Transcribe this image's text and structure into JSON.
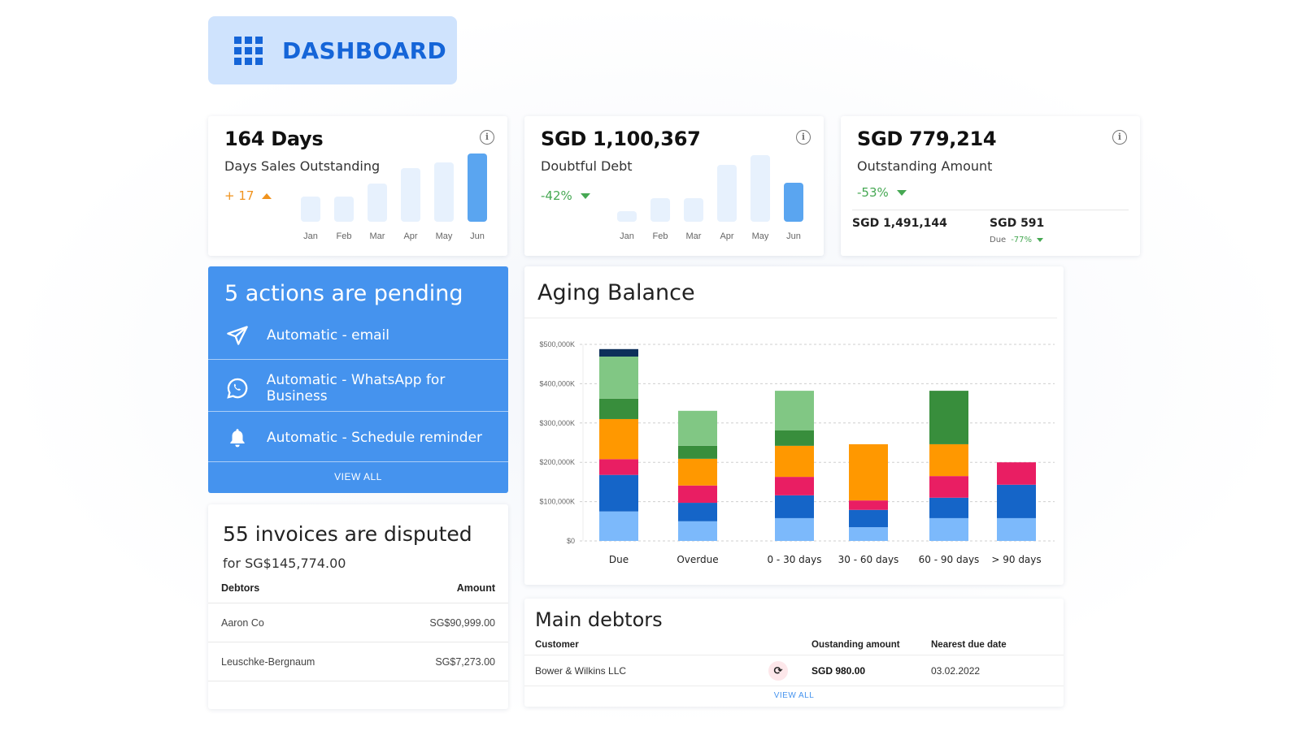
{
  "header": {
    "title": "DASHBOARD",
    "icon": "grid-icon",
    "bg_color": "#cfe3fd",
    "accent": "#1565d8"
  },
  "kpis": [
    {
      "value": "164 Days",
      "label": "Days Sales Outstanding",
      "delta": "+ 17",
      "delta_direction": "up",
      "delta_color": "#f0931e",
      "bars": {
        "months": [
          "Jan",
          "Feb",
          "Mar",
          "Apr",
          "May",
          "Jun"
        ],
        "relative_values": [
          0.37,
          0.37,
          0.56,
          0.78,
          0.87,
          1.0
        ],
        "active_index": 5
      }
    },
    {
      "value": "SGD 1,100,367",
      "label": "Doubtful Debt",
      "delta": "-42%",
      "delta_direction": "down",
      "delta_color": "#46a853",
      "bars": {
        "months": [
          "Jan",
          "Feb",
          "Mar",
          "Apr",
          "May",
          "Jun"
        ],
        "relative_values": [
          0.16,
          0.35,
          0.35,
          0.83,
          0.98,
          0.57
        ],
        "active_index": 5
      }
    },
    {
      "value": "SGD 779,214",
      "label": "Outstanding Amount",
      "delta": "-53%",
      "delta_direction": "down",
      "delta_color": "#46a853",
      "split": {
        "left_value": "SGD 1,491,144",
        "right_value": "SGD 591",
        "right_sub_label": "Due",
        "right_sub_delta": "-77%"
      }
    }
  ],
  "actions": {
    "title": "5 actions are pending",
    "items": [
      {
        "icon": "paper-plane-icon",
        "label": "Automatic - email"
      },
      {
        "icon": "whatsapp-icon",
        "label": "Automatic - WhatsApp for Business"
      },
      {
        "icon": "bell-icon",
        "label": "Automatic - Schedule reminder"
      }
    ],
    "view_all": "VIEW ALL",
    "bg_color": "#4593ee"
  },
  "disputed": {
    "title": "55 invoices are disputed",
    "subtitle": "for SG$145,774.00",
    "columns": [
      "Debtors",
      "Amount"
    ],
    "rows": [
      {
        "debtor": "Aaron Co",
        "amount": "SG$90,999.00"
      },
      {
        "debtor": "Leuschke-Bergnaum",
        "amount": "SG$7,273.00"
      }
    ]
  },
  "aging": {
    "title": "Aging Balance"
  },
  "chart_data": {
    "type": "bar",
    "stacked": true,
    "title": "Aging Balance",
    "categories": [
      "Due",
      "Overdue",
      "0 - 30 days",
      "30 - 60 days",
      "60 - 90 days",
      "> 90 days"
    ],
    "series": [
      {
        "name": "series-1",
        "color": "#7cb9fb",
        "values": [
          75,
          50,
          58,
          35,
          58,
          58
        ]
      },
      {
        "name": "series-2",
        "color": "#1565c8",
        "values": [
          93,
          47,
          58,
          44,
          52,
          85
        ]
      },
      {
        "name": "series-3",
        "color": "#e91e63",
        "values": [
          40,
          44,
          47,
          24,
          55,
          57
        ]
      },
      {
        "name": "series-4",
        "color": "#ff9800",
        "values": [
          102,
          68,
          79,
          143,
          81,
          0
        ]
      },
      {
        "name": "series-5",
        "color": "#388e3c",
        "values": [
          52,
          33,
          39,
          0,
          136,
          0
        ]
      },
      {
        "name": "series-6",
        "color": "#81c784",
        "values": [
          107,
          89,
          101,
          0,
          0,
          0
        ]
      },
      {
        "name": "series-7",
        "color": "#0d2f5a",
        "values": [
          19,
          0,
          0,
          0,
          0,
          0
        ]
      }
    ],
    "value_unit": "$ thousands (K)",
    "yticks": [
      "$0",
      "$100,000K",
      "$200,000K",
      "$300,000K",
      "$400,000K",
      "$500,000K"
    ],
    "ytick_values": [
      0,
      100,
      200,
      300,
      400,
      500
    ],
    "ylim": [
      0,
      500
    ],
    "grid": true,
    "legend": "none",
    "xlabel": "",
    "ylabel": ""
  },
  "debtors": {
    "title": "Main debtors",
    "columns": [
      "Customer",
      "",
      "Oustanding amount",
      "Nearest due date"
    ],
    "rows": [
      {
        "customer": "Bower & Wilkins LLC",
        "status_icon": "sync-alert-icon",
        "amount": "SGD 980.00",
        "due_date": "03.02.2022"
      }
    ],
    "view_all": "VIEW ALL"
  }
}
